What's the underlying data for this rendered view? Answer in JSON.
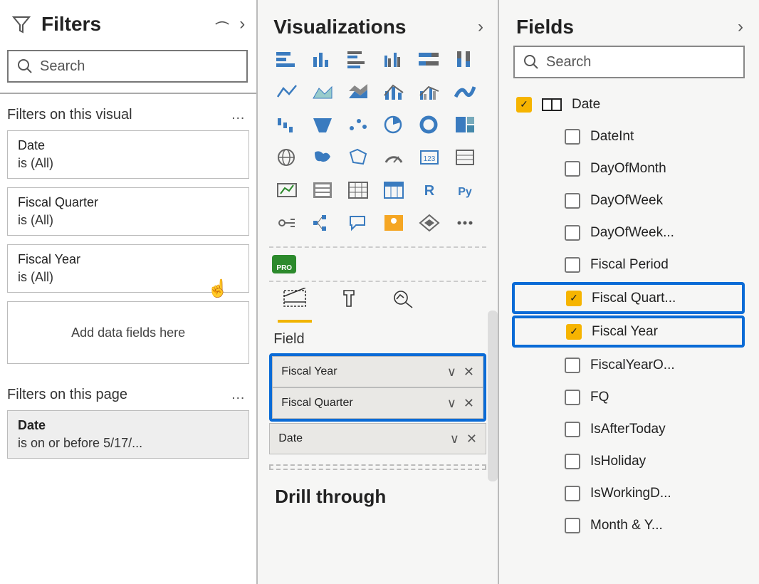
{
  "filters": {
    "title": "Filters",
    "search_placeholder": "Search",
    "section_visual": "Filters on this visual",
    "dots": "…",
    "cards": [
      {
        "name": "Date",
        "value": "is (All)"
      },
      {
        "name": "Fiscal Quarter",
        "value": "is (All)"
      },
      {
        "name": "Fiscal Year",
        "value": "is (All)"
      }
    ],
    "drop_text": "Add data fields here",
    "section_page": "Filters on this page",
    "page_card": {
      "name": "Date",
      "value": "is on or before 5/17/..."
    }
  },
  "viz": {
    "title": "Visualizations",
    "pro_badge": "PRO",
    "field_label": "Field",
    "wells_highlighted": [
      "Fiscal Year",
      "Fiscal Quarter"
    ],
    "wells_rest": [
      "Date"
    ],
    "drill_label": "Drill through"
  },
  "fields": {
    "title": "Fields",
    "search_placeholder": "Search",
    "table_name": "Date",
    "items": [
      {
        "label": "DateInt",
        "checked": false
      },
      {
        "label": "DayOfMonth",
        "checked": false
      },
      {
        "label": "DayOfWeek",
        "checked": false
      },
      {
        "label": "DayOfWeek...",
        "checked": false
      },
      {
        "label": "Fiscal Period",
        "checked": false
      },
      {
        "label": "Fiscal Quart...",
        "checked": true,
        "highlight": true
      },
      {
        "label": "Fiscal Year",
        "checked": true,
        "highlight": true
      },
      {
        "label": "FiscalYearO...",
        "checked": false
      },
      {
        "label": "FQ",
        "checked": false
      },
      {
        "label": "IsAfterToday",
        "checked": false
      },
      {
        "label": "IsHoliday",
        "checked": false
      },
      {
        "label": "IsWorkingD...",
        "checked": false
      },
      {
        "label": "Month & Y...",
        "checked": false
      }
    ]
  }
}
